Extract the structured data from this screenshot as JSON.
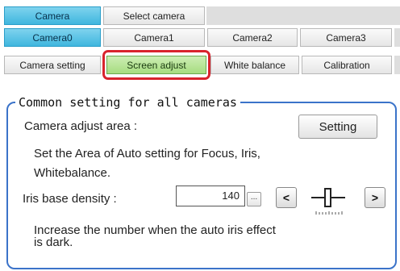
{
  "tabs_row1": [
    {
      "label": "Camera",
      "state": "active"
    },
    {
      "label": "Select camera",
      "state": "normal"
    }
  ],
  "tabs_row2": [
    {
      "label": "Camera0",
      "state": "active"
    },
    {
      "label": "Camera1",
      "state": "normal"
    },
    {
      "label": "Camera2",
      "state": "normal"
    },
    {
      "label": "Camera3",
      "state": "normal"
    }
  ],
  "tabs_row3": [
    {
      "label": "Camera setting",
      "state": "normal"
    },
    {
      "label": "Screen adjust",
      "state": "selected"
    },
    {
      "label": "White balance",
      "state": "normal"
    },
    {
      "label": "Calibration",
      "state": "normal"
    }
  ],
  "panel": {
    "title": "Common setting for all cameras",
    "camera_adjust_label": "Camera adjust area :",
    "setting_button": "Setting",
    "area_description_line1": "Set the Area of Auto setting for Focus, Iris,",
    "area_description_line2": "Whitebalance.",
    "iris_label": "Iris base density :",
    "iris_value": "140",
    "ellipsis_label": "...",
    "decrease_label": "<",
    "increase_label": ">",
    "hint_line1": "Increase the number when the auto iris effect",
    "hint_line2": "is dark."
  },
  "colors": {
    "active_tab": "#3fb6de",
    "selected_tab": "#a6dc80",
    "highlight_ring": "#d9232d",
    "panel_border": "#3b73c9"
  },
  "icons": [
    "ellipsis-icon",
    "slider-icon"
  ]
}
